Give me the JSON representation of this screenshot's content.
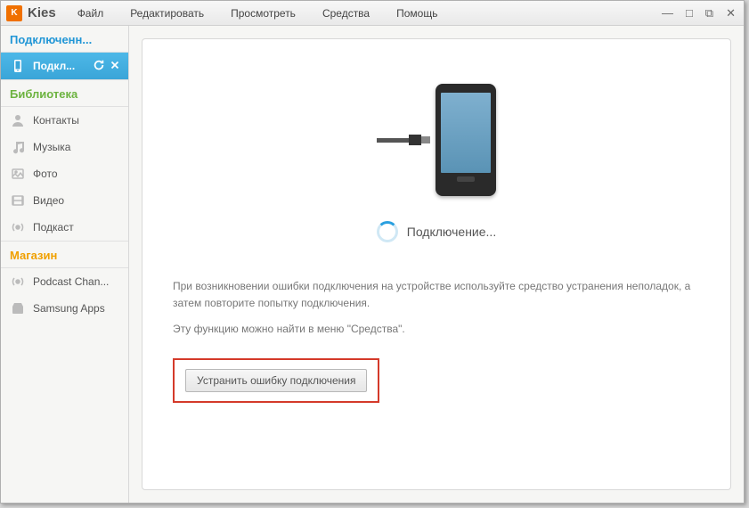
{
  "app": {
    "logo_text": "K",
    "name": "Kies"
  },
  "menu": {
    "file": "Файл",
    "edit": "Редактировать",
    "view": "Просмотреть",
    "tools": "Средства",
    "help": "Помощь"
  },
  "sidebar": {
    "connected_header": "Подключенн...",
    "device": {
      "label": "Подкл..."
    },
    "library_header": "Библиотека",
    "library": {
      "contacts": "Контакты",
      "music": "Музыка",
      "photo": "Фото",
      "video": "Видео",
      "podcast": "Подкаст"
    },
    "store_header": "Магазин",
    "store": {
      "podcast_channel": "Podcast Chan...",
      "samsung_apps": "Samsung Apps"
    }
  },
  "main": {
    "status": "Подключение...",
    "hint1": "При возникновении ошибки подключения на устройстве используйте средство устранения неполадок, а затем повторите попытку подключения.",
    "hint2": "Эту функцию можно найти в меню \"Средства\".",
    "fix_button": "Устранить ошибку подключения"
  }
}
